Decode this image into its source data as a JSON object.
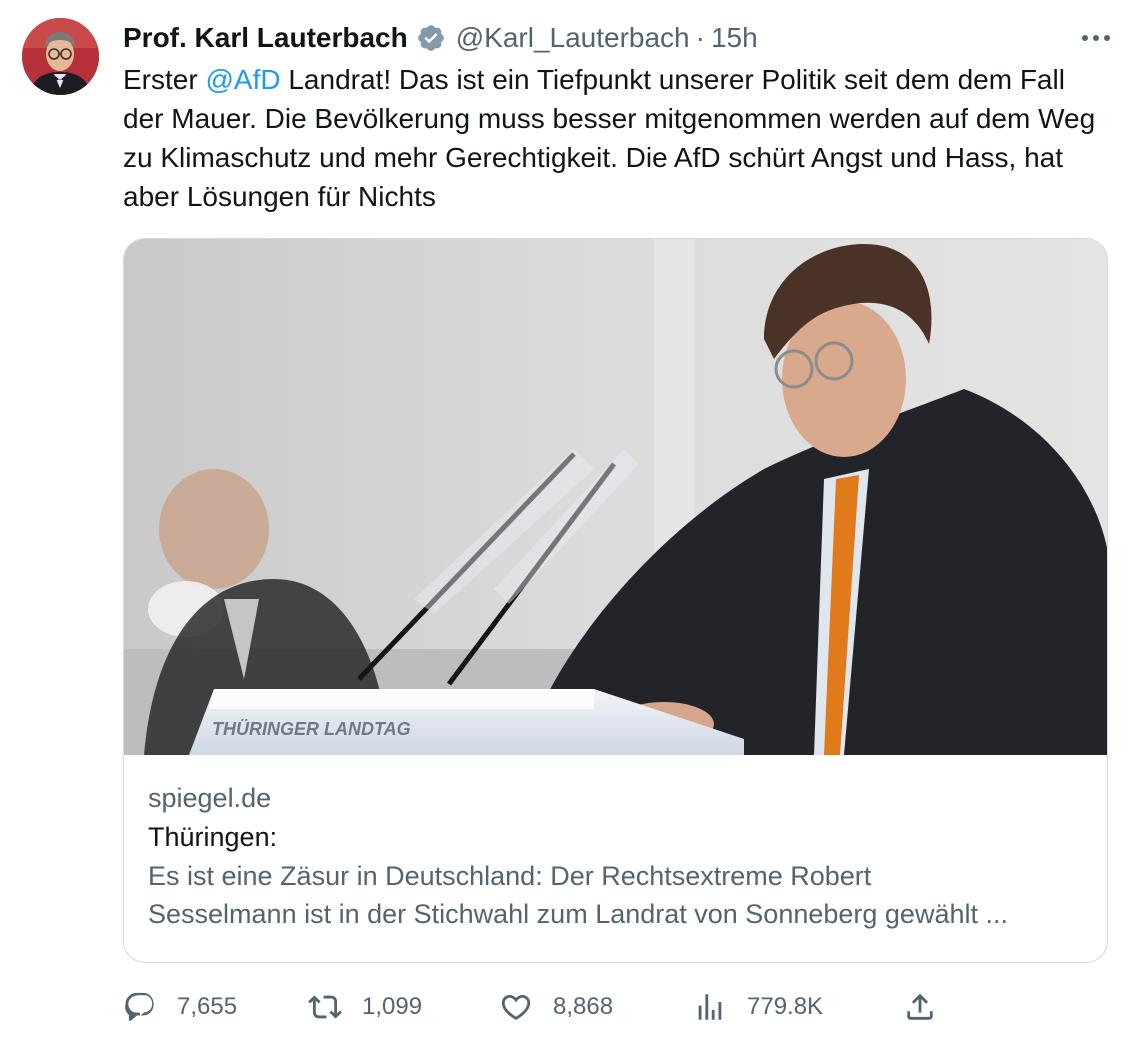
{
  "author": {
    "name": "Prof. Karl Lauterbach",
    "handle": "@Karl_Lauterbach",
    "separator": "·",
    "time": "15h"
  },
  "tweet": {
    "text_before_mention": "Erster ",
    "mention": "@AfD",
    "text_after_mention": " Landrat! Das ist ein Tiefpunkt unserer Politik seit dem dem Fall der Mauer. Die Bevölkerung muss besser mitgenommen werden auf dem Weg zu Klimaschutz und mehr Gerechtigkeit. Die AfD schürt Angst und Hass, hat aber Lösungen für Nichts"
  },
  "card": {
    "image_text": "THÜRINGER LANDTAG",
    "domain": "spiegel.de",
    "title": "Thüringen:",
    "description_line1": "Es ist eine Zäsur in Deutschland: Der Rechtsextreme Robert",
    "description_line2": "Sesselmann ist in der Stichwahl zum Landrat von Sonneberg gewählt ..."
  },
  "actions": {
    "replies": "7,655",
    "retweets": "1,099",
    "likes": "8,868",
    "views": "779.8K"
  },
  "icons": {
    "verified": "verified-badge-icon",
    "more": "more-dots-icon",
    "reply": "reply-icon",
    "retweet": "retweet-icon",
    "like": "heart-icon",
    "views": "views-chart-icon",
    "share": "share-icon"
  },
  "colors": {
    "accent": "#1d9bf0",
    "secondary_text": "#536471",
    "border": "#cfd9de"
  }
}
